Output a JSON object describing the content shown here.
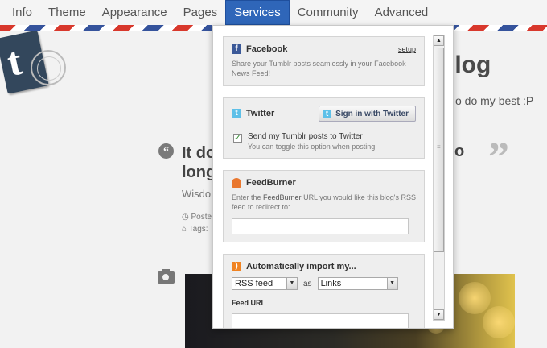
{
  "nav": {
    "items": [
      {
        "label": "Info"
      },
      {
        "label": "Theme"
      },
      {
        "label": "Appearance"
      },
      {
        "label": "Pages"
      },
      {
        "label": "Services"
      },
      {
        "label": "Community"
      },
      {
        "label": "Advanced"
      }
    ],
    "active": "Services",
    "active_color": "#2f66b9"
  },
  "blog": {
    "title_fragment": "blog",
    "description_fragment": "o do my best :P",
    "post": {
      "title_line1": "It doe",
      "title_line2": "long",
      "title_right": "o",
      "source_fragment": "Wisdom",
      "posted_fragment": "Poste",
      "tags_fragment": "Tags:"
    }
  },
  "services": {
    "facebook": {
      "title": "Facebook",
      "setup_link": "setup",
      "description": "Share your Tumblr posts seamlessly in your Facebook News Feed!",
      "icon": "facebook-icon"
    },
    "twitter": {
      "title": "Twitter",
      "button": "Sign in with Twitter",
      "checkbox_checked": true,
      "checkbox_label": "Send my Tumblr posts to Twitter",
      "checkbox_hint": "You can toggle this option when posting.",
      "icon": "twitter-icon"
    },
    "feedburner": {
      "title": "FeedBurner",
      "description_pre": "Enter the ",
      "description_link": "FeedBurner",
      "description_post": " URL you would like this blog's RSS feed to redirect to:",
      "url_value": "",
      "icon": "feedburner-icon"
    },
    "import": {
      "title": "Automatically import my...",
      "source_selected": "RSS feed",
      "as_label": "as",
      "type_selected": "Links",
      "feed_url_label": "Feed URL",
      "icon": "rss-icon"
    }
  },
  "scrollbar": {
    "position": 0
  }
}
